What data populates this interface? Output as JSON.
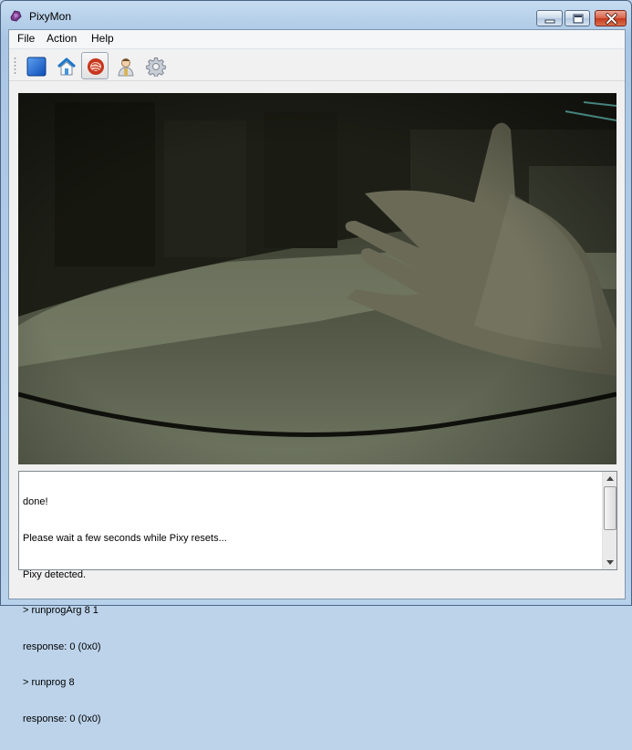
{
  "window": {
    "title": "PixyMon",
    "icon": "pixymon-app-icon",
    "controls": [
      "minimize-icon",
      "maximize-icon",
      "close-icon"
    ]
  },
  "menubar": {
    "items": [
      {
        "label": "File"
      },
      {
        "label": "Action"
      },
      {
        "label": "Help"
      }
    ]
  },
  "toolbar": {
    "buttons": [
      {
        "icon": "run-pixy-icon",
        "active": false
      },
      {
        "icon": "home-icon",
        "active": false
      },
      {
        "icon": "raw-video-icon",
        "active": true
      },
      {
        "icon": "person-icon",
        "active": false
      },
      {
        "icon": "gear-icon",
        "active": false
      }
    ]
  },
  "video": {
    "description_icon": "camera-feed"
  },
  "console": {
    "lines": [
      "done!",
      "Please wait a few seconds while Pixy resets...",
      "Pixy detected.",
      "> runprogArg 8 1",
      "response: 0 (0x0)",
      "> runprog 8",
      "response: 0 (0x0)"
    ]
  },
  "colors": {
    "titlebar": "#b8d1ea",
    "close_button": "#c4391d",
    "client_bg": "#f0f0f0"
  }
}
